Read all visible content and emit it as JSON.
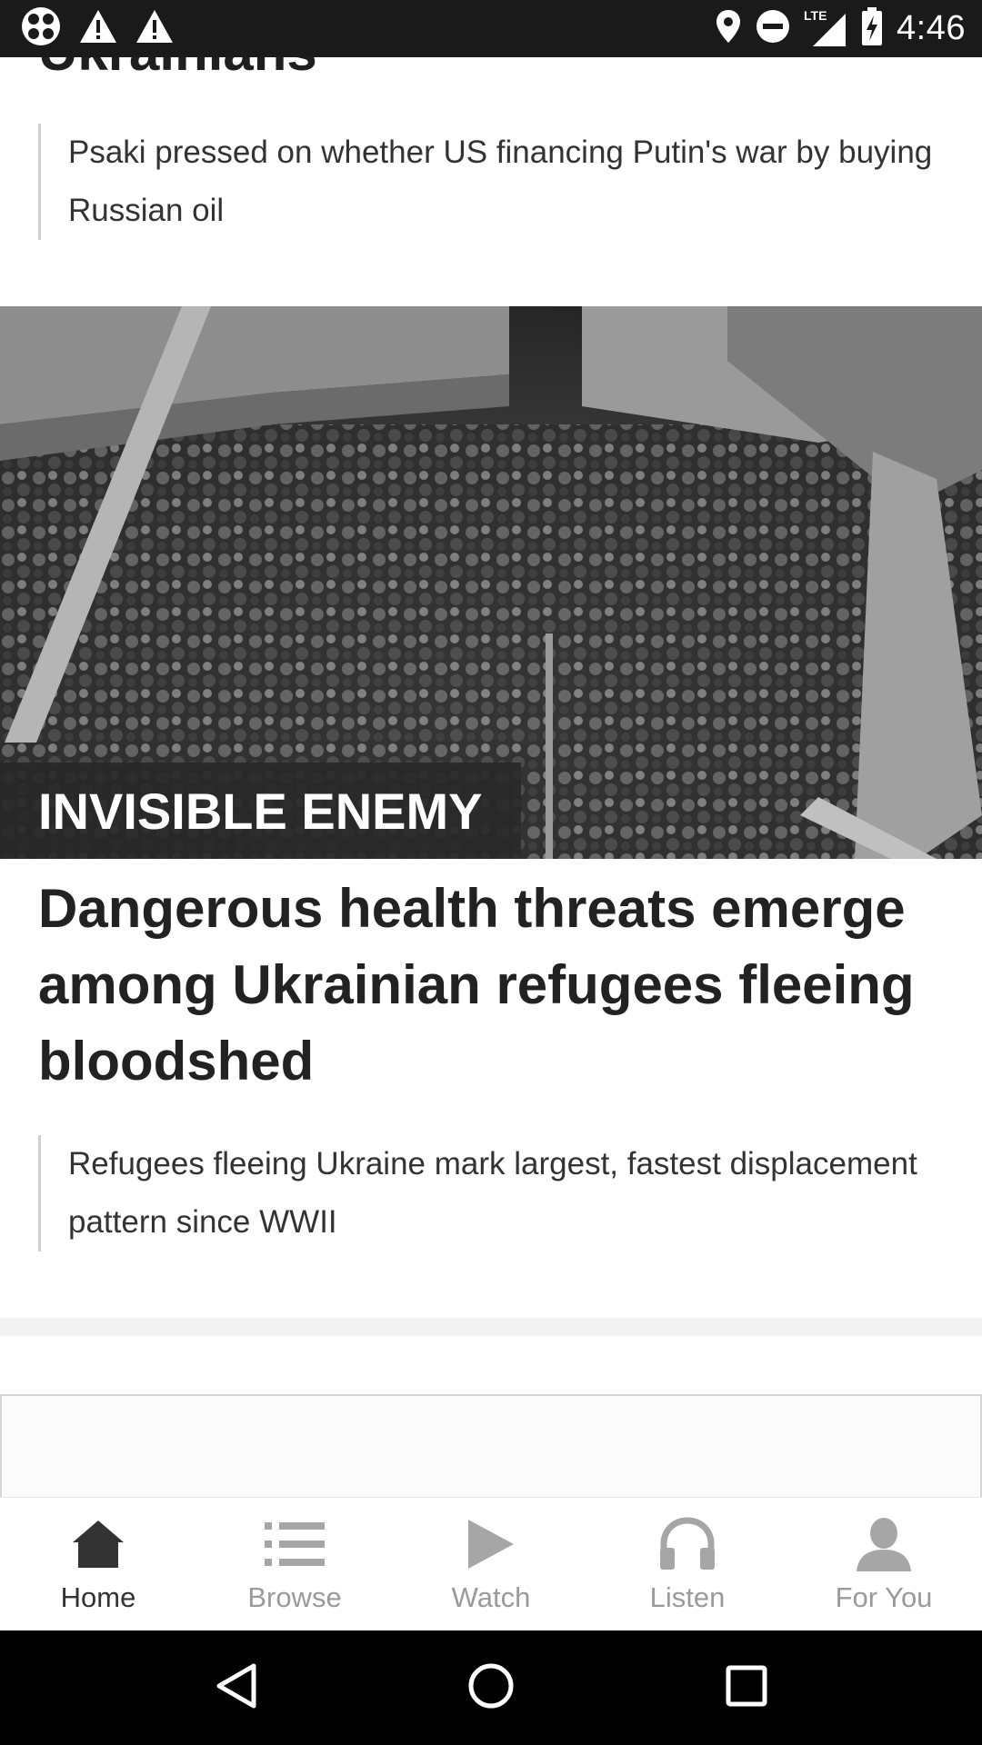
{
  "status_bar": {
    "time": "4:46",
    "network": "LTE",
    "left_icons": [
      "app-notification-icon",
      "warning-icon",
      "warning-icon"
    ],
    "right_icons": [
      "location-icon",
      "do-not-disturb-icon",
      "lte-signal-icon",
      "battery-charging-icon"
    ]
  },
  "feed": {
    "prev_headline_fragment": "Ukrainians",
    "prev_summary": "Psaki pressed on whether US financing Putin's war by buying Russian oil",
    "story": {
      "tag": "INVISIBLE ENEMY",
      "headline": "Dangerous health threats emerge among Ukrainian refugees fleeing bloodshed",
      "summary": "Refugees fleeing Ukraine mark largest, fastest displacement pattern since WWII"
    }
  },
  "bottom_nav": {
    "items": [
      {
        "label": "Home",
        "icon": "home-icon",
        "active": true
      },
      {
        "label": "Browse",
        "icon": "list-icon",
        "active": false
      },
      {
        "label": "Watch",
        "icon": "play-icon",
        "active": false
      },
      {
        "label": "Listen",
        "icon": "headphones-icon",
        "active": false
      },
      {
        "label": "For You",
        "icon": "person-icon",
        "active": false
      }
    ]
  },
  "system_nav": {
    "buttons": [
      "back-icon",
      "home-circle-icon",
      "recents-icon"
    ]
  }
}
